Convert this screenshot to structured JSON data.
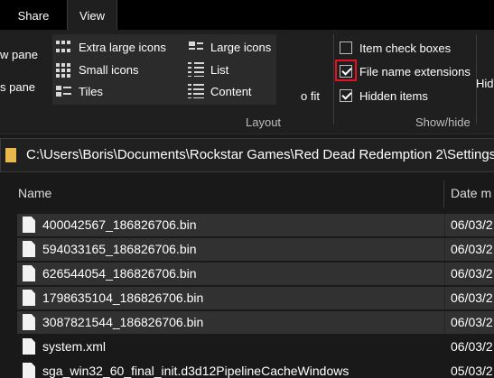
{
  "tabs": [
    {
      "label": "Share"
    },
    {
      "label": "View"
    }
  ],
  "ribbon": {
    "pane_labels": [
      "w pane",
      "s pane"
    ],
    "layout": {
      "items": [
        {
          "label": "Extra large icons",
          "icon": "extra-large-icons-icon"
        },
        {
          "label": "Small icons",
          "icon": "small-icons-icon"
        },
        {
          "label": "Tiles",
          "icon": "tiles-icon"
        },
        {
          "label": "Large icons",
          "icon": "large-icons-icon"
        },
        {
          "label": "List",
          "icon": "list-icon"
        },
        {
          "label": "Content",
          "icon": "content-icon"
        }
      ],
      "group_label": "Layout",
      "fit_label": "o fit"
    },
    "show_hide": {
      "items": [
        {
          "label": "Item check boxes",
          "checked": false
        },
        {
          "label": "File name extensions",
          "checked": true,
          "highlighted": true
        },
        {
          "label": "Hidden items",
          "checked": true
        }
      ],
      "group_label": "Show/hide",
      "hide_label": "Hid"
    },
    "highlight_color": "#e81123"
  },
  "address": {
    "path": "C:\\Users\\Boris\\Documents\\Rockstar Games\\Red Dead Redemption 2\\Settings",
    "folder_icon_color": "#e8b84a"
  },
  "file_list": {
    "columns": [
      "Name",
      "Date m"
    ],
    "rows": [
      {
        "name": "400042567_186826706.bin",
        "date": "06/03/2",
        "selected": true
      },
      {
        "name": "594033165_186826706.bin",
        "date": "06/03/2",
        "selected": true
      },
      {
        "name": "626544054_186826706.bin",
        "date": "06/03/2",
        "selected": true
      },
      {
        "name": "1798635104_186826706.bin",
        "date": "06/03/2",
        "selected": true
      },
      {
        "name": "3087821544_186826706.bin",
        "date": "06/03/2",
        "selected": true
      },
      {
        "name": "system.xml",
        "date": "06/03/2",
        "selected": false
      },
      {
        "name": "sga_win32_60_final_init.d3d12PipelineCacheWindows",
        "date": "05/03/2",
        "selected": false
      }
    ]
  }
}
